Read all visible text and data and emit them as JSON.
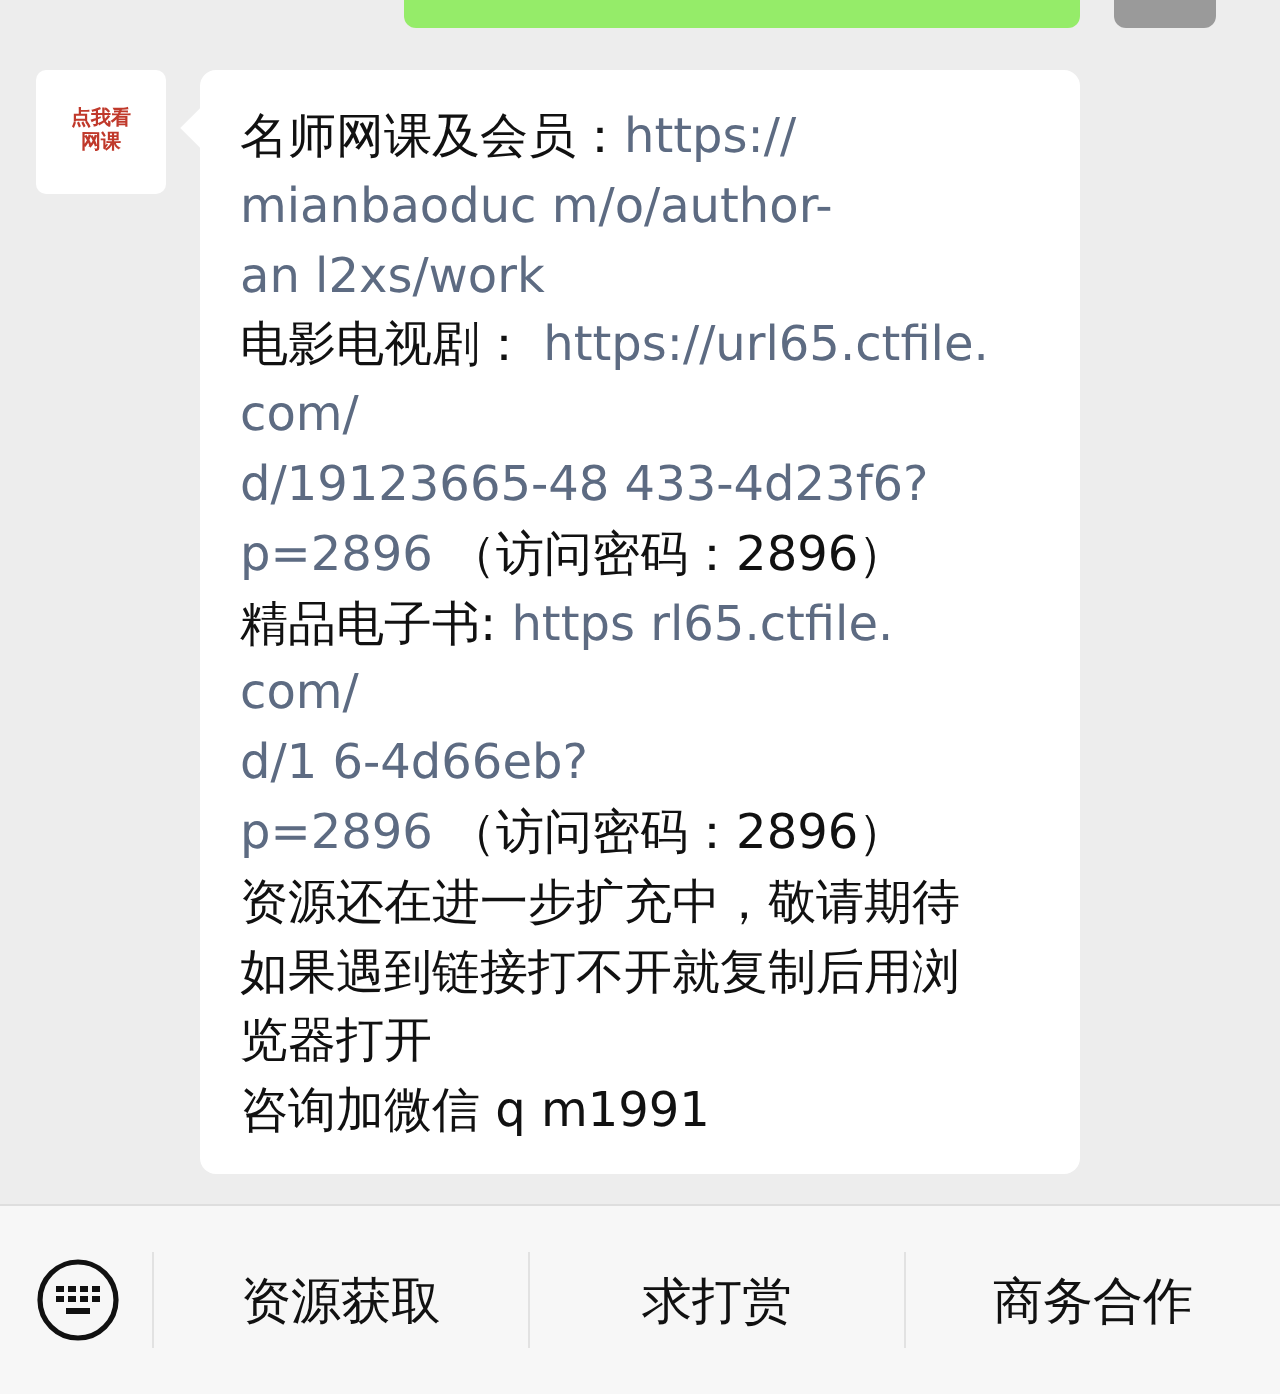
{
  "contact_avatar": {
    "caption": [
      "点我看",
      "网课"
    ]
  },
  "message": {
    "lines": [
      {
        "parts": [
          {
            "kind": "text",
            "text": "名师网课及会员："
          },
          {
            "kind": "link",
            "text": "https://"
          }
        ]
      },
      {
        "parts": [
          {
            "kind": "link",
            "text": "mianbaoduc m/o/author-"
          }
        ]
      },
      {
        "parts": [
          {
            "kind": "link",
            "text": "an l2xs/work"
          }
        ]
      },
      {
        "parts": [
          {
            "kind": "text",
            "text": "电影电视剧： "
          },
          {
            "kind": "link",
            "text": "https://url65.ctfile."
          }
        ]
      },
      {
        "parts": [
          {
            "kind": "link",
            "text": "com/"
          }
        ]
      },
      {
        "parts": [
          {
            "kind": "link",
            "text": "d/19123665-48 433-4d23f6?"
          }
        ]
      },
      {
        "parts": [
          {
            "kind": "link",
            "text": "p=2896"
          },
          {
            "kind": "text",
            "text": " （访问密码：2896）"
          }
        ]
      },
      {
        "parts": [
          {
            "kind": "text",
            "text": "精品电子书: "
          },
          {
            "kind": "link",
            "text": "https rl65.ctfile."
          }
        ]
      },
      {
        "parts": [
          {
            "kind": "link",
            "text": "com/"
          }
        ]
      },
      {
        "parts": [
          {
            "kind": "link",
            "text": "d/1 6-4d66eb?"
          }
        ]
      },
      {
        "parts": [
          {
            "kind": "link",
            "text": "p=2896"
          },
          {
            "kind": "text",
            "text": " （访问密码：2896）"
          }
        ]
      },
      {
        "parts": [
          {
            "kind": "text",
            "text": "资源还在进一步扩充中，敬请期待"
          }
        ]
      },
      {
        "parts": [
          {
            "kind": "text",
            "text": "如果遇到链接打不开就复制后用浏"
          }
        ]
      },
      {
        "parts": [
          {
            "kind": "text",
            "text": "览器打开"
          }
        ]
      },
      {
        "parts": [
          {
            "kind": "text",
            "text": "咨询加微信 q m1991"
          }
        ]
      }
    ]
  },
  "menu": [
    "资源获取",
    "求打赏",
    "商务合作"
  ]
}
